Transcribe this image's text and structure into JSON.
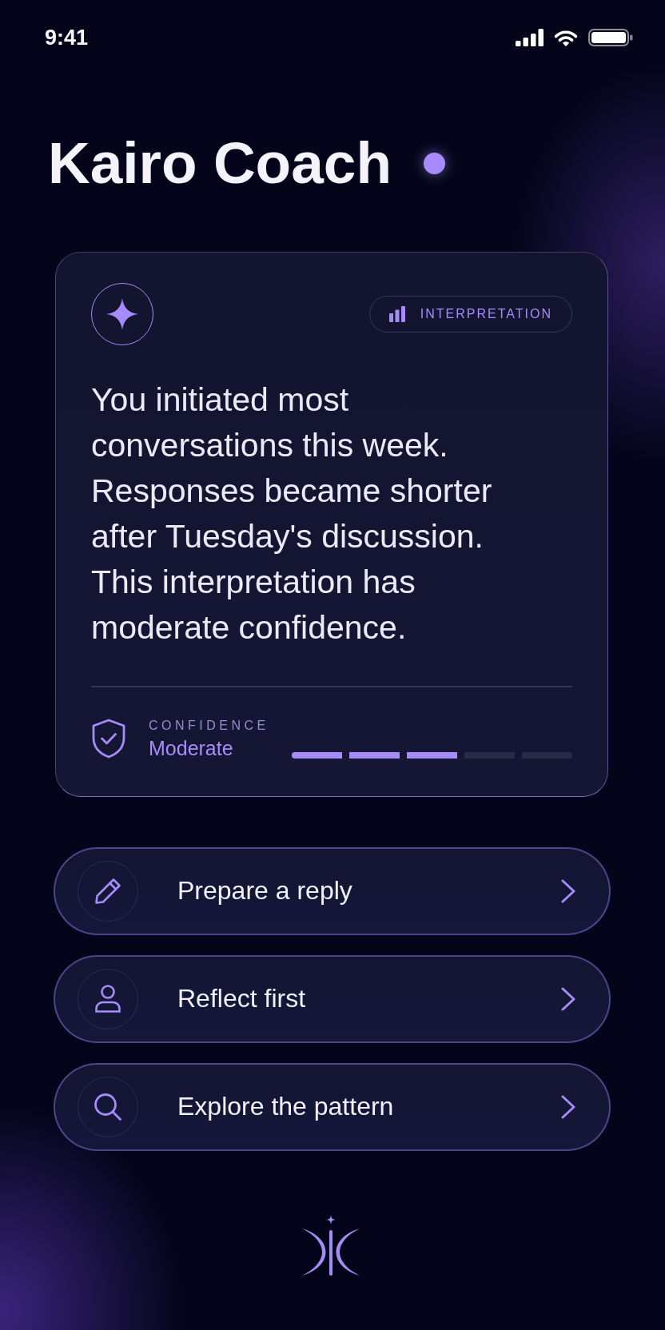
{
  "status_bar": {
    "time": "9:41"
  },
  "header": {
    "title": "Kairo Coach"
  },
  "insight_card": {
    "tag": "INTERPRETATION",
    "text": "You initiated most conversations this week. Responses became shorter after Tuesday's discussion. This interpretation has moderate confidence.",
    "confidence": {
      "label": "CONFIDENCE",
      "value": "Moderate",
      "level": 0.6
    }
  },
  "actions": [
    {
      "kind": "reply",
      "label": "Prepare a reply"
    },
    {
      "kind": "reflect",
      "label": "Reflect first"
    },
    {
      "kind": "explore",
      "label": "Explore the pattern"
    }
  ]
}
